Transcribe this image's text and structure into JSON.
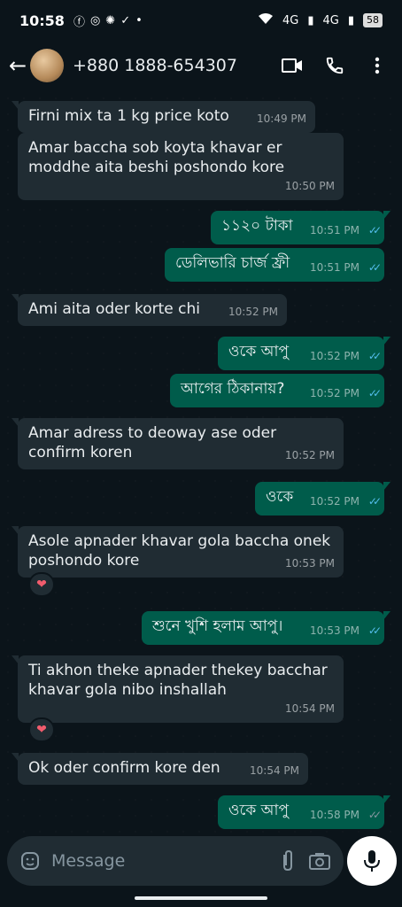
{
  "status": {
    "time": "10:58",
    "network_1": "4G",
    "network_2": "4G",
    "battery": "58"
  },
  "header": {
    "phone": "+880 1888-654307",
    "back_icon": "arrow-left-icon",
    "video_icon": "video-call-icon",
    "call_icon": "phone-icon",
    "menu_icon": "more-vert-icon"
  },
  "messages": [
    {
      "dir": "in",
      "text": "Firni mix ta 1 kg price koto",
      "time": "10:49 PM"
    },
    {
      "dir": "in",
      "text": "Amar baccha sob koyta khavar er moddhe aita beshi poshondo kore",
      "time": "10:50 PM"
    },
    {
      "dir": "out",
      "text": "১১২০ টাকা",
      "time": "10:51 PM"
    },
    {
      "dir": "out",
      "text": "ডেলিভারি চার্জ ফ্রী",
      "time": "10:51 PM"
    },
    {
      "dir": "in",
      "text": "Ami aita oder korte chi",
      "time": "10:52 PM"
    },
    {
      "dir": "out",
      "text": "ওকে আপু",
      "time": "10:52 PM"
    },
    {
      "dir": "out",
      "text": "আগের ঠিকানায়?",
      "time": "10:52 PM"
    },
    {
      "dir": "in",
      "text": "Amar adress to deoway ase oder confirm koren",
      "time": "10:52 PM"
    },
    {
      "dir": "out",
      "text": "ওকে",
      "time": "10:52 PM"
    },
    {
      "dir": "in",
      "text": "Asole apnader khavar gola baccha onek poshondo kore",
      "time": "10:53 PM",
      "reaction": "❤"
    },
    {
      "dir": "out",
      "text": "শুনে খুশি হলাম আপু।",
      "time": "10:53 PM"
    },
    {
      "dir": "in",
      "text": "Ti akhon theke apnader thekey bacchar khavar gola nibo inshallah",
      "time": "10:54 PM",
      "reaction": "❤"
    },
    {
      "dir": "in",
      "text": "Ok oder confirm kore den",
      "time": "10:54 PM"
    },
    {
      "dir": "out",
      "text": "ওকে আপু",
      "time": "10:58 PM"
    }
  ],
  "composer": {
    "placeholder": "Message",
    "emoji_icon": "sticker-icon",
    "attach_icon": "paperclip-icon",
    "camera_icon": "camera-icon",
    "mic_icon": "microphone-icon"
  },
  "colors": {
    "background": "#0b141a",
    "incoming": "#202c33",
    "outgoing": "#005c4b",
    "read_ticks": "#53bdeb"
  }
}
